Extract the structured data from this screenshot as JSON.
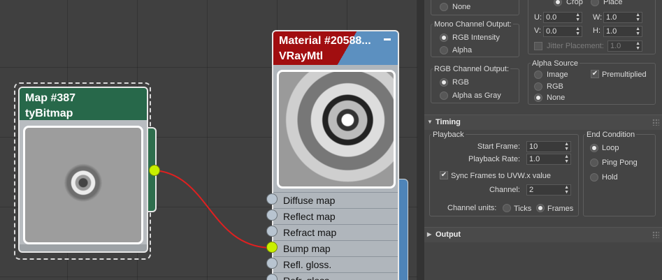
{
  "map_node": {
    "title": "Map #387",
    "subtitle": "tyBitmap"
  },
  "material_node": {
    "title": "Material #20588...",
    "subtitle": "VRayMtl",
    "slots": [
      "Diffuse map",
      "Reflect map",
      "Refract map",
      "Bump map",
      "Refl. gloss.",
      "Refr. gloss"
    ],
    "connected_slot": "Bump map"
  },
  "colors": {
    "map_header": "#27684a",
    "material_red": "#a10e10",
    "material_blue": "#5c90c0",
    "wire": "#e02020",
    "socket_active": "#c9f000"
  },
  "panel": {
    "top_radio_none": "None",
    "crop_label": "Crop",
    "place_label": "Place",
    "mono_output": {
      "title": "Mono Channel Output:",
      "options": [
        "RGB Intensity",
        "Alpha"
      ],
      "selected": "RGB Intensity"
    },
    "rgb_output": {
      "title": "RGB Channel Output:",
      "options": [
        "RGB",
        "Alpha as Gray"
      ],
      "selected": "RGB"
    },
    "crop": {
      "u_label": "U:",
      "u_value": "0.0",
      "v_label": "V:",
      "v_value": "0.0",
      "w_label": "W:",
      "w_value": "1.0",
      "h_label": "H:",
      "h_value": "1.0",
      "jitter_label": "Jitter Placement:",
      "jitter_value": "1.0"
    },
    "alpha_source": {
      "title": "Alpha Source",
      "options": [
        "Image",
        "RGB",
        "None"
      ],
      "selected": "None",
      "premultiplied_label": "Premultiplied",
      "premultiplied": true
    },
    "timing": {
      "title": "Timing",
      "playback_title": "Playback",
      "start_frame_label": "Start Frame:",
      "start_frame": "10",
      "playback_rate_label": "Playback Rate:",
      "playback_rate": "1.0",
      "sync_label": "Sync Frames to UVW.x value",
      "sync": true,
      "channel_label": "Channel:",
      "channel": "2",
      "channel_units_label": "Channel units:",
      "units_options": [
        "Ticks",
        "Frames"
      ],
      "units_selected": "Frames",
      "end_condition_title": "End Condition",
      "end_options": [
        "Loop",
        "Ping Pong",
        "Hold"
      ],
      "end_selected": "Loop"
    },
    "output_title": "Output"
  }
}
